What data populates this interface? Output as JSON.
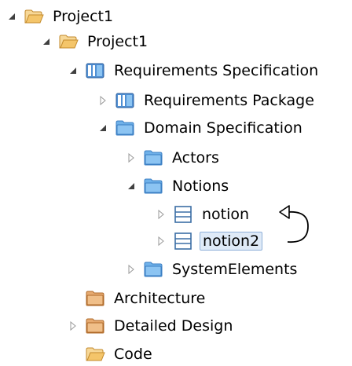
{
  "tree": {
    "project_root": "Project1",
    "project_child": "Project1",
    "requirements_spec": "Requirements Specification",
    "requirements_package": "Requirements Package",
    "domain_spec": "Domain Specification",
    "actors": "Actors",
    "notions": "Notions",
    "notion": "notion",
    "notion2": "notion2",
    "system_elements": "SystemElements",
    "architecture": "Architecture",
    "detailed_design": "Detailed Design",
    "code": "Code"
  },
  "selected_item": "notion2",
  "colors": {
    "selection_bg": "#dfeaf7",
    "selection_border": "#8fb0d9",
    "folder_blue": "#5aa0e0",
    "folder_orange": "#d89a5a",
    "folder_open": "#f4c56a"
  },
  "icons": {
    "expanded": "triangle-down-icon",
    "collapsed": "triangle-right-icon",
    "open_folder": "open-folder-icon",
    "blue_folder": "blue-folder-icon",
    "brown_folder": "brown-folder-icon",
    "package": "package-folder-icon",
    "notion": "notion-element-icon"
  }
}
